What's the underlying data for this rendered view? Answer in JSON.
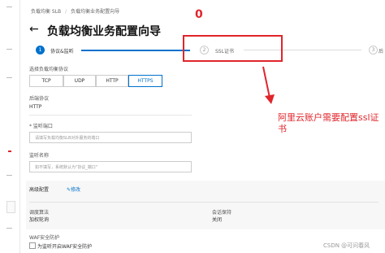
{
  "breadcrumb": {
    "part1": "负载均衡 SLB",
    "sep": "/",
    "part2": "负载均衡业务配置向导"
  },
  "header": {
    "back_arrow": "←",
    "title": "负载均衡业务配置向导"
  },
  "steps": [
    {
      "num": "1",
      "label": "协议&监听"
    },
    {
      "num": "2",
      "label": "SSL证书"
    },
    {
      "num": "3",
      "label": "后"
    }
  ],
  "annotation": {
    "marker": "0",
    "text": "阿里云账户需要配置ssl证书"
  },
  "form": {
    "protocol_label": "选择负载均衡协议",
    "protocols": [
      "TCP",
      "UDP",
      "HTTP",
      "HTTPS"
    ],
    "selected_protocol": "HTTPS",
    "backend_protocol_label": "后端协议",
    "backend_protocol_value": "HTTP",
    "port_label": "* 监听端口",
    "port_placeholder": "请填写负载均衡SLB对外服务的端口",
    "name_label": "监听名称",
    "name_placeholder": "如不填写，系统默认为\"协议_端口\"",
    "advanced_title": "高级配置",
    "modify_link": "修改",
    "adv": {
      "sched_label": "调度算法",
      "sched_value": "加权轮询",
      "session_label": "会话保持",
      "session_value": "关闭"
    },
    "waf_label": "WAF安全防护",
    "waf_checkbox_label": "为监听开启WAF安全防护"
  },
  "watermark": "CSDN @可问春风",
  "colors": {
    "accent": "#0070cc",
    "annotation": "#e0252b"
  }
}
